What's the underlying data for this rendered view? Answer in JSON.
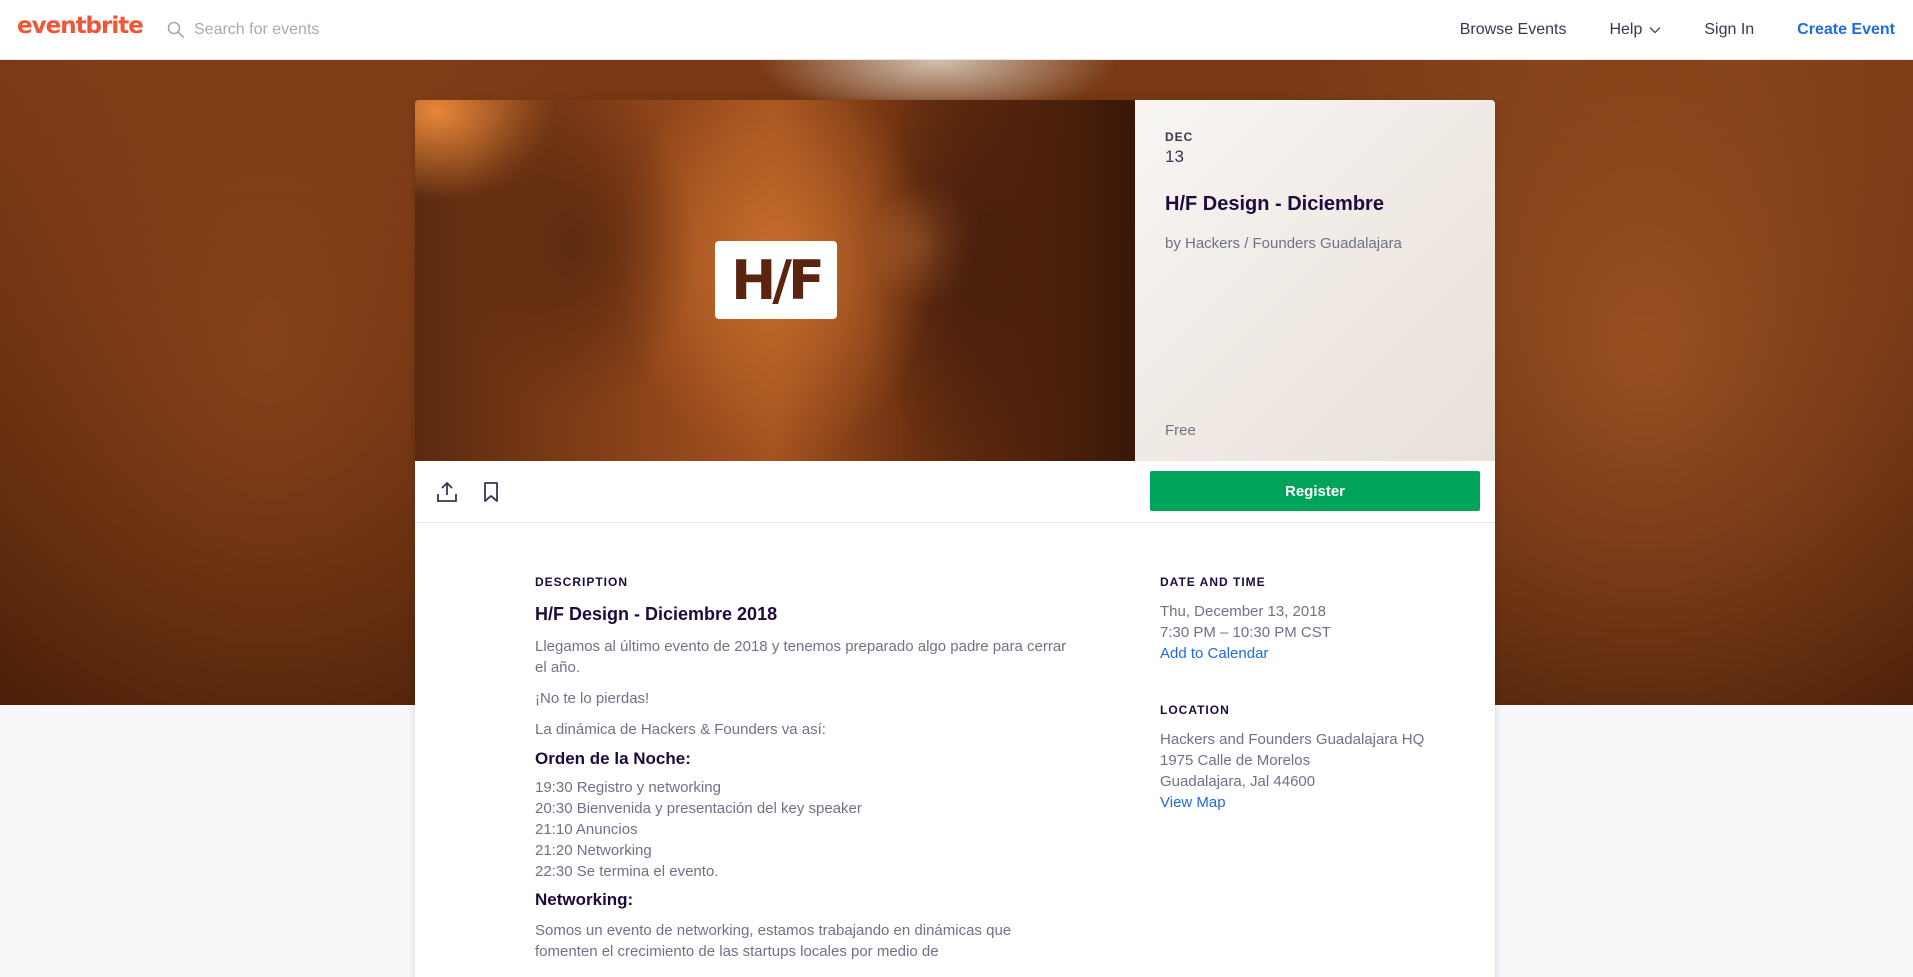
{
  "nav": {
    "logo": "eventbrite",
    "search_placeholder": "Search for events",
    "browse": "Browse Events",
    "help": "Help",
    "sign_in": "Sign In",
    "create": "Create Event"
  },
  "event": {
    "month": "DEC",
    "day": "13",
    "title": "H/F Design - Diciembre",
    "organizer": "by Hackers / Founders Guadalajara",
    "price": "Free",
    "logo_text": "H/F"
  },
  "actions": {
    "register": "Register"
  },
  "description": {
    "label": "DESCRIPTION",
    "heading": "H/F Design - Diciembre 2018",
    "para1": "Llegamos al último evento de 2018 y tenemos preparado algo padre para cerrar el año.",
    "para2": "¡No te lo pierdas!",
    "para3": "La dinámica de Hackers & Founders va así:",
    "agenda_heading": "Orden de la Noche:",
    "agenda": [
      "19:30 Registro y networking",
      "20:30 Bienvenida y presentación del key speaker",
      "21:10 Anuncios",
      "21:20 Networking",
      "22:30 Se termina el evento."
    ],
    "networking_heading": "Networking:",
    "para4": "Somos un evento de networking, estamos trabajando en dinámicas que fomenten el crecimiento de las startups locales por medio de"
  },
  "date_time": {
    "label": "DATE AND TIME",
    "date": "Thu, December 13, 2018",
    "time": "7:30 PM – 10:30 PM CST",
    "add_calendar": "Add to Calendar"
  },
  "location": {
    "label": "LOCATION",
    "venue": "Hackers and Founders Guadalajara HQ",
    "street": "1975 Calle de Morelos",
    "city": "Guadalajara, Jal 44600",
    "view_map": "View Map"
  },
  "colors": {
    "brand": "#f05537",
    "register": "#00a35a",
    "link": "#1f6be0"
  }
}
